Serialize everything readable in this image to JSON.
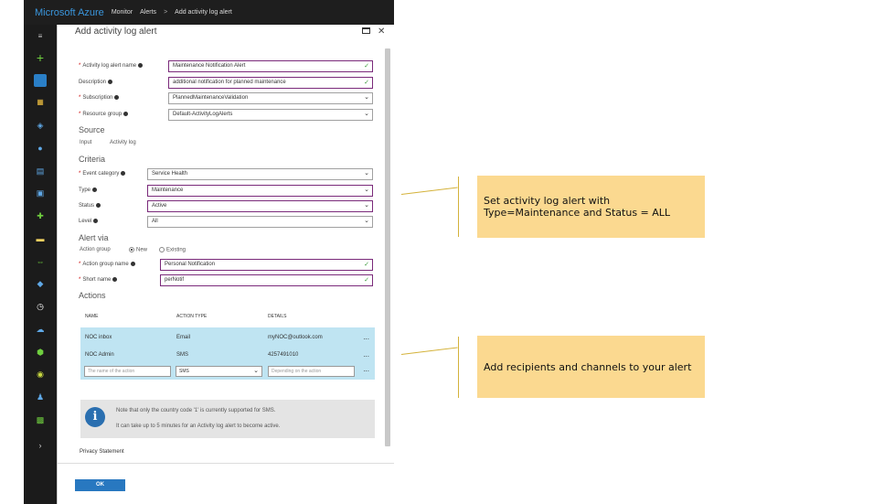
{
  "topbar": {
    "brand": "Microsoft Azure",
    "crumbs": [
      "Monitor",
      "Alerts",
      "Add activity log alert"
    ],
    "separator": ">"
  },
  "blade": {
    "title": "Add activity log alert",
    "maximize_icon": "square-icon",
    "close_glyph": "✕"
  },
  "form": {
    "alert_name": {
      "label": "Activity log alert name",
      "value": "Maintenance Notification Alert"
    },
    "description": {
      "label": "Description",
      "value": "additional notification for planned maintenance"
    },
    "subscription": {
      "label": "Subscription",
      "value": "PlannedMaintenanceValidation"
    },
    "resource_group": {
      "label": "Resource group",
      "value": "Default-ActivityLogAlerts"
    }
  },
  "source": {
    "heading": "Source",
    "input_label": "Input",
    "input_value": "Activity log"
  },
  "criteria": {
    "heading": "Criteria",
    "event_category": {
      "label": "Event category",
      "value": "Service Health"
    },
    "type": {
      "label": "Type",
      "value": "Maintenance"
    },
    "status": {
      "label": "Status",
      "value": "Active"
    },
    "level": {
      "label": "Level",
      "value": "All"
    }
  },
  "alert_via": {
    "heading": "Alert via",
    "action_group_label": "Action group",
    "option_new": "New",
    "option_existing": "Existing",
    "selected": "New",
    "action_group_name": {
      "label": "Action group name",
      "value": "Personal Notification"
    },
    "short_name": {
      "label": "Short name",
      "value": "perNotif"
    }
  },
  "actions": {
    "heading": "Actions",
    "columns": [
      "NAME",
      "ACTION TYPE",
      "DETAILS"
    ],
    "rows": [
      {
        "name": "NOC inbox",
        "type": "Email",
        "details": "myNOC@outlook.com"
      },
      {
        "name": "NOC Admin",
        "type": "SMS",
        "details": "4257491010"
      }
    ],
    "more_glyph": "...",
    "new_row": {
      "name_placeholder": "The name of the action",
      "type_value": "SMS",
      "details_placeholder": "Depending on the action"
    }
  },
  "note": {
    "line1": "Note that only the country code '1' is currently supported for SMS.",
    "line2": "It can take up to 5 minutes for an Activity log alert to become active."
  },
  "privacy": "Privacy Statement",
  "ok_label": "OK",
  "callouts": [
    {
      "lines": [
        "Set activity log alert with",
        "Type=Maintenance and Status = ALL"
      ]
    },
    {
      "lines": [
        "Add recipients and channels to your alert"
      ]
    }
  ],
  "colors": {
    "brand_blue": "#3a96dd",
    "callout_bg": "#fbd990",
    "table_row": "#bfe4f2",
    "ok_button": "#2878c0"
  }
}
